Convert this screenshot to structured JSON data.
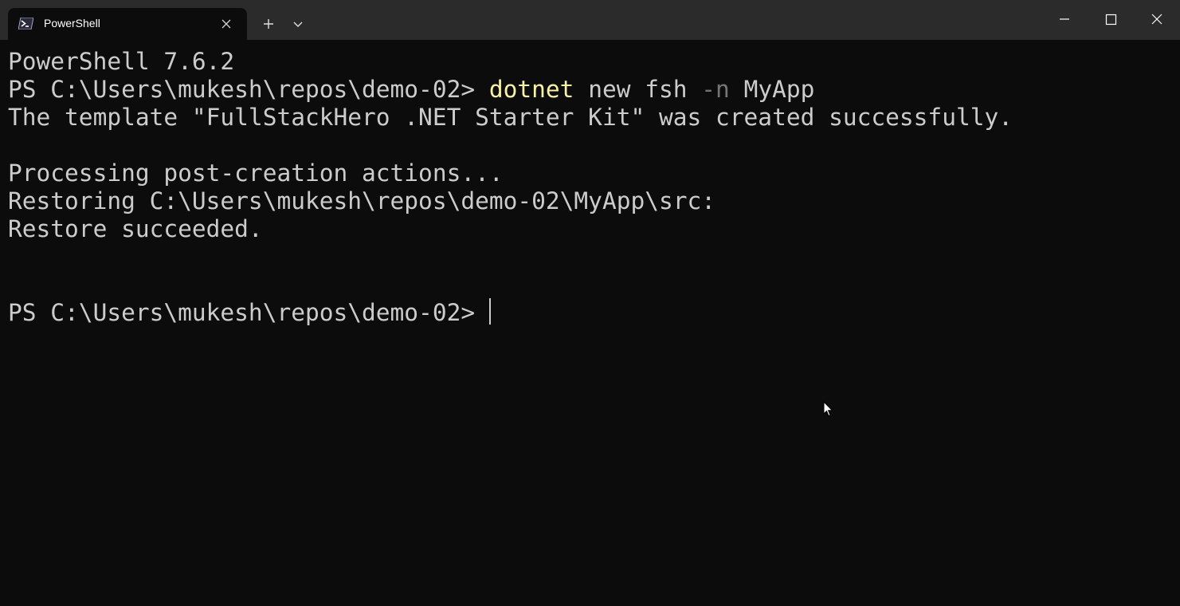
{
  "window": {
    "tab": {
      "title": "PowerShell",
      "icon": "powershell-icon"
    },
    "controls": {
      "new_tab_icon": "plus-icon",
      "dropdown_icon": "chevron-down-icon",
      "minimize_icon": "minimize-icon",
      "maximize_icon": "maximize-icon",
      "close_icon": "close-icon"
    }
  },
  "terminal": {
    "version_line": "PowerShell 7.6.2",
    "prompt": "PS C:\\Users\\mukesh\\repos\\demo-02> ",
    "command": {
      "exe": "dotnet",
      "args_before": " new fsh ",
      "param": "-n",
      "args_after": " MyApp"
    },
    "output": {
      "template_created": "The template \"FullStackHero .NET Starter Kit\" was created successfully.",
      "processing": "Processing post-creation actions...",
      "restoring": "Restoring C:\\Users\\mukesh\\repos\\demo-02\\MyApp\\src:",
      "restore_result": "Restore succeeded."
    },
    "final_prompt": "PS C:\\Users\\mukesh\\repos\\demo-02> "
  },
  "colors": {
    "background": "#0c0c0c",
    "titlebar": "#2b2b2b",
    "text": "#cccccc",
    "command_exe": "#f9f1a5",
    "command_param": "#767676"
  }
}
